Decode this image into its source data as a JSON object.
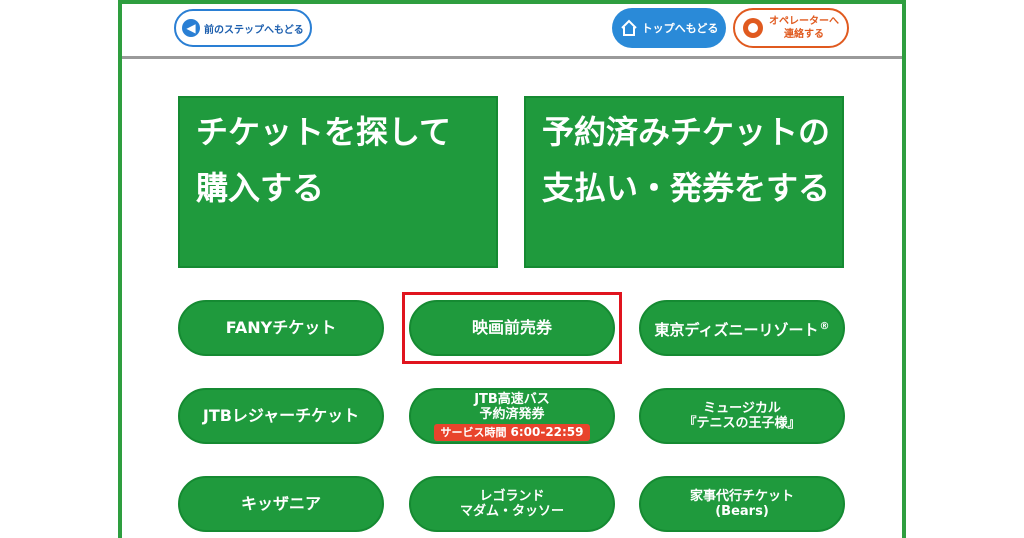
{
  "header": {
    "back_label": "前のステップへもどる",
    "top_label": "トップへもどる",
    "operator_line1": "オペレーターへ",
    "operator_line2": "連絡する"
  },
  "main_buttons": [
    {
      "line1": "チケットを探して",
      "line2": "購入する"
    },
    {
      "line1": "予約済みチケットの",
      "line2": "支払い・発券をする"
    }
  ],
  "categories": [
    {
      "label": "FANYチケット"
    },
    {
      "label": "映画前売券",
      "highlighted": true
    },
    {
      "label": "東京ディズニーリゾート",
      "mark": "®"
    },
    {
      "label": "JTBレジャーチケット"
    },
    {
      "line1": "JTB高速バス",
      "line2": "予約済発券",
      "badge_label": "サービス時間",
      "badge_time": "6:00-22:59"
    },
    {
      "line1": "ミュージカル",
      "line2": "『テニスの王子様』"
    },
    {
      "label": "キッザニア"
    },
    {
      "line1": "レゴランド",
      "line2": "マダム・タッソー"
    },
    {
      "line1": "家事代行チケット",
      "line2": "(Bears)"
    }
  ],
  "colors": {
    "green": "#1f9a3d",
    "blue": "#2a8ad8",
    "orange": "#e05a1f",
    "highlight_red": "#e0141e"
  },
  "icons": {
    "back": "arrow-left-icon",
    "top": "home-icon",
    "operator": "operator-face-icon"
  }
}
